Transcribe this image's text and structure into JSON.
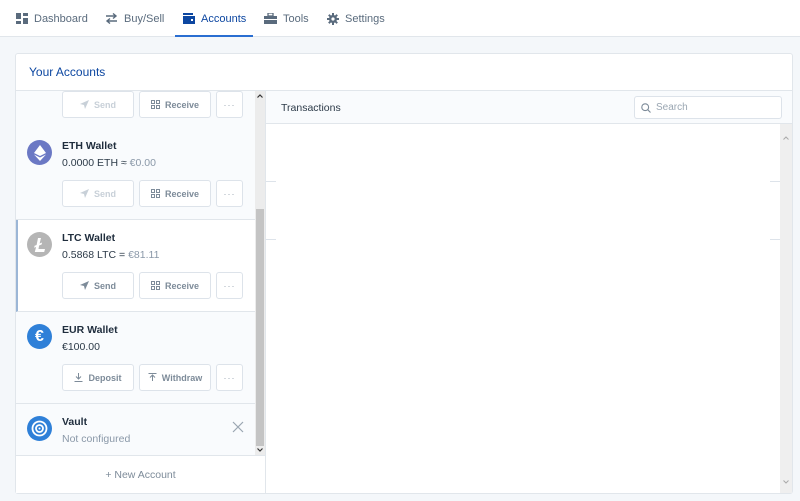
{
  "nav": {
    "items": [
      {
        "label": "Dashboard",
        "icon": "dashboard-icon",
        "active": false
      },
      {
        "label": "Buy/Sell",
        "icon": "swap-icon",
        "active": false
      },
      {
        "label": "Accounts",
        "icon": "wallet-icon",
        "active": true
      },
      {
        "label": "Tools",
        "icon": "toolbox-icon",
        "active": false
      },
      {
        "label": "Settings",
        "icon": "gear-icon",
        "active": false
      }
    ]
  },
  "accounts_panel": {
    "title": "Your Accounts",
    "partial_top": {
      "buttons": [
        {
          "label": "Send",
          "icon": "send-icon",
          "disabled": true
        },
        {
          "label": "Receive",
          "icon": "qr-icon",
          "disabled": false
        },
        {
          "label": "···",
          "icon": "more-icon"
        }
      ]
    },
    "accounts": [
      {
        "name": "ETH Wallet",
        "balance": "0.0000 ETH",
        "separator": "≈",
        "fiat": "€0.00",
        "icon": "ethereum-icon",
        "color": "#6b78c4",
        "buttons": [
          {
            "label": "Send",
            "icon": "send-icon",
            "disabled": true
          },
          {
            "label": "Receive",
            "icon": "qr-icon",
            "disabled": false
          },
          {
            "label": "···",
            "icon": "more-icon"
          }
        ]
      },
      {
        "name": "LTC Wallet",
        "balance": "0.5868 LTC",
        "separator": "=",
        "fiat": "€81.11",
        "icon": "litecoin-icon",
        "color": "#b5b5b5",
        "selected": true,
        "buttons": [
          {
            "label": "Send",
            "icon": "send-icon",
            "disabled": false
          },
          {
            "label": "Receive",
            "icon": "qr-icon",
            "disabled": false
          },
          {
            "label": "···",
            "icon": "more-icon"
          }
        ]
      },
      {
        "name": "EUR Wallet",
        "balance": "€100.00",
        "icon": "euro-icon",
        "color": "#2f80d8",
        "buttons": [
          {
            "label": "Deposit",
            "icon": "download-icon",
            "disabled": false
          },
          {
            "label": "Withdraw",
            "icon": "upload-icon",
            "disabled": false
          },
          {
            "label": "···",
            "icon": "more-icon"
          }
        ]
      },
      {
        "name": "Vault",
        "status": "Not configured",
        "icon": "vault-icon",
        "color": "#2f80d8"
      }
    ],
    "new_account_label": "+ New Account"
  },
  "transactions": {
    "title": "Transactions",
    "search_placeholder": "Search",
    "search_value": ""
  },
  "colors": {
    "accent": "#0d47a1",
    "active_underline": "#2a6ed1"
  }
}
